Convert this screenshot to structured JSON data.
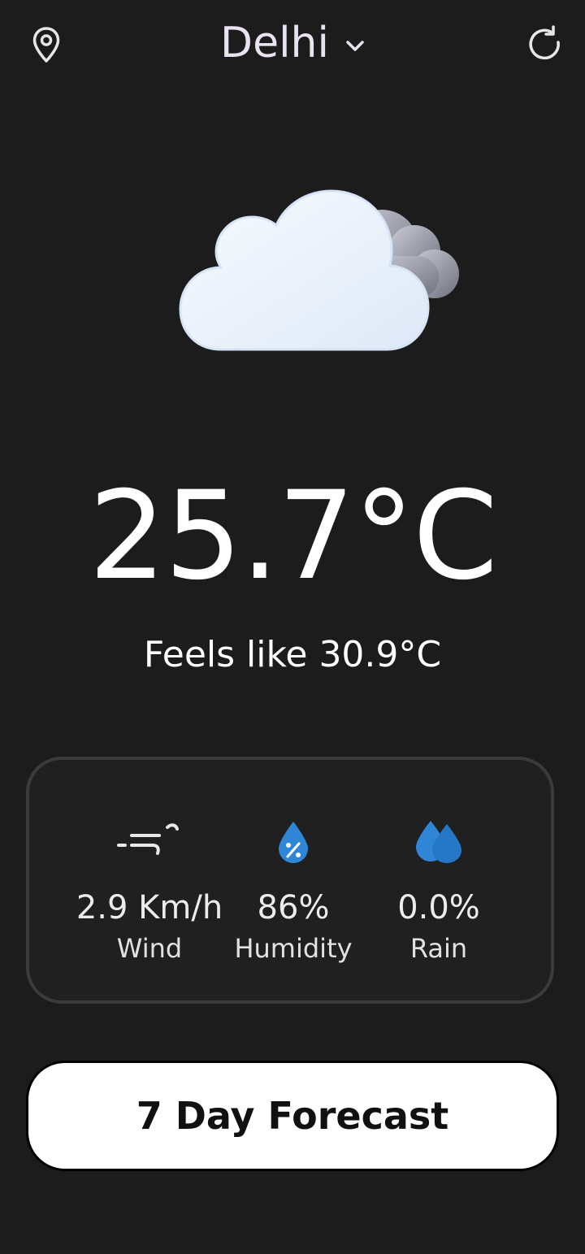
{
  "header": {
    "city": "Delhi",
    "location_icon": "map-pin-icon",
    "dropdown_icon": "chevron-down-icon",
    "refresh_icon": "refresh-icon"
  },
  "current": {
    "condition_icon": "cloudy-icon",
    "temperature": "25.7°C",
    "feels_like": "Feels like 30.9°C"
  },
  "stats": [
    {
      "icon": "wind-icon",
      "value": "2.9 Km/h",
      "label": "Wind"
    },
    {
      "icon": "humidity-icon",
      "value": "86%",
      "label": "Humidity"
    },
    {
      "icon": "rain-icon",
      "value": "0.0%",
      "label": "Rain"
    }
  ],
  "forecast_button": {
    "label": "7 Day Forecast"
  },
  "colors": {
    "background": "#1c1c1c",
    "card_border": "#3b3b3b",
    "accent_blue": "#2f86d6",
    "button_bg": "#ffffff"
  }
}
